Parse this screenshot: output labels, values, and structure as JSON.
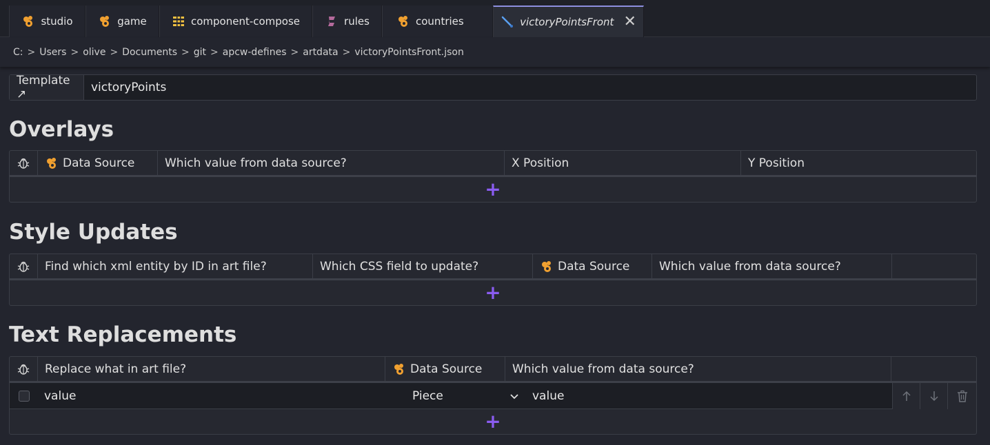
{
  "tabs": [
    {
      "label": "studio",
      "icon": "component-icon"
    },
    {
      "label": "game",
      "icon": "component-icon"
    },
    {
      "label": "component-compose",
      "icon": "compose-icon"
    },
    {
      "label": "rules",
      "icon": "rules-icon"
    },
    {
      "label": "countries",
      "icon": "component-icon"
    },
    {
      "label": "victoryPointsFront",
      "icon": "brush-icon",
      "active": true
    }
  ],
  "breadcrumb": [
    "C:",
    "Users",
    "olive",
    "Documents",
    "git",
    "apcw-defines",
    "artdata",
    "victoryPointsFront.json"
  ],
  "breadcrumb_sep": ">",
  "template": {
    "label": "Template ↗",
    "value": "victoryPoints"
  },
  "overlays": {
    "heading": "Overlays",
    "columns": [
      "Data Source",
      "Which value from data source?",
      "X Position",
      "Y Position"
    ],
    "add_label": "+"
  },
  "style_updates": {
    "heading": "Style Updates",
    "columns": [
      "Find which xml entity by ID in art file?",
      "Which CSS field to update?",
      "Data Source",
      "Which value from data source?"
    ],
    "add_label": "+"
  },
  "text_replacements": {
    "heading": "Text Replacements",
    "columns": [
      "Replace what in art file?",
      "Data Source",
      "Which value from data source?"
    ],
    "rows": [
      {
        "replace": "value",
        "source": "Piece",
        "value": "value"
      }
    ],
    "add_label": "+"
  },
  "colors": {
    "accent": "#8a5cf0",
    "icon_orange": "#f0a030",
    "tab_active_border": "#8d8fe0"
  }
}
